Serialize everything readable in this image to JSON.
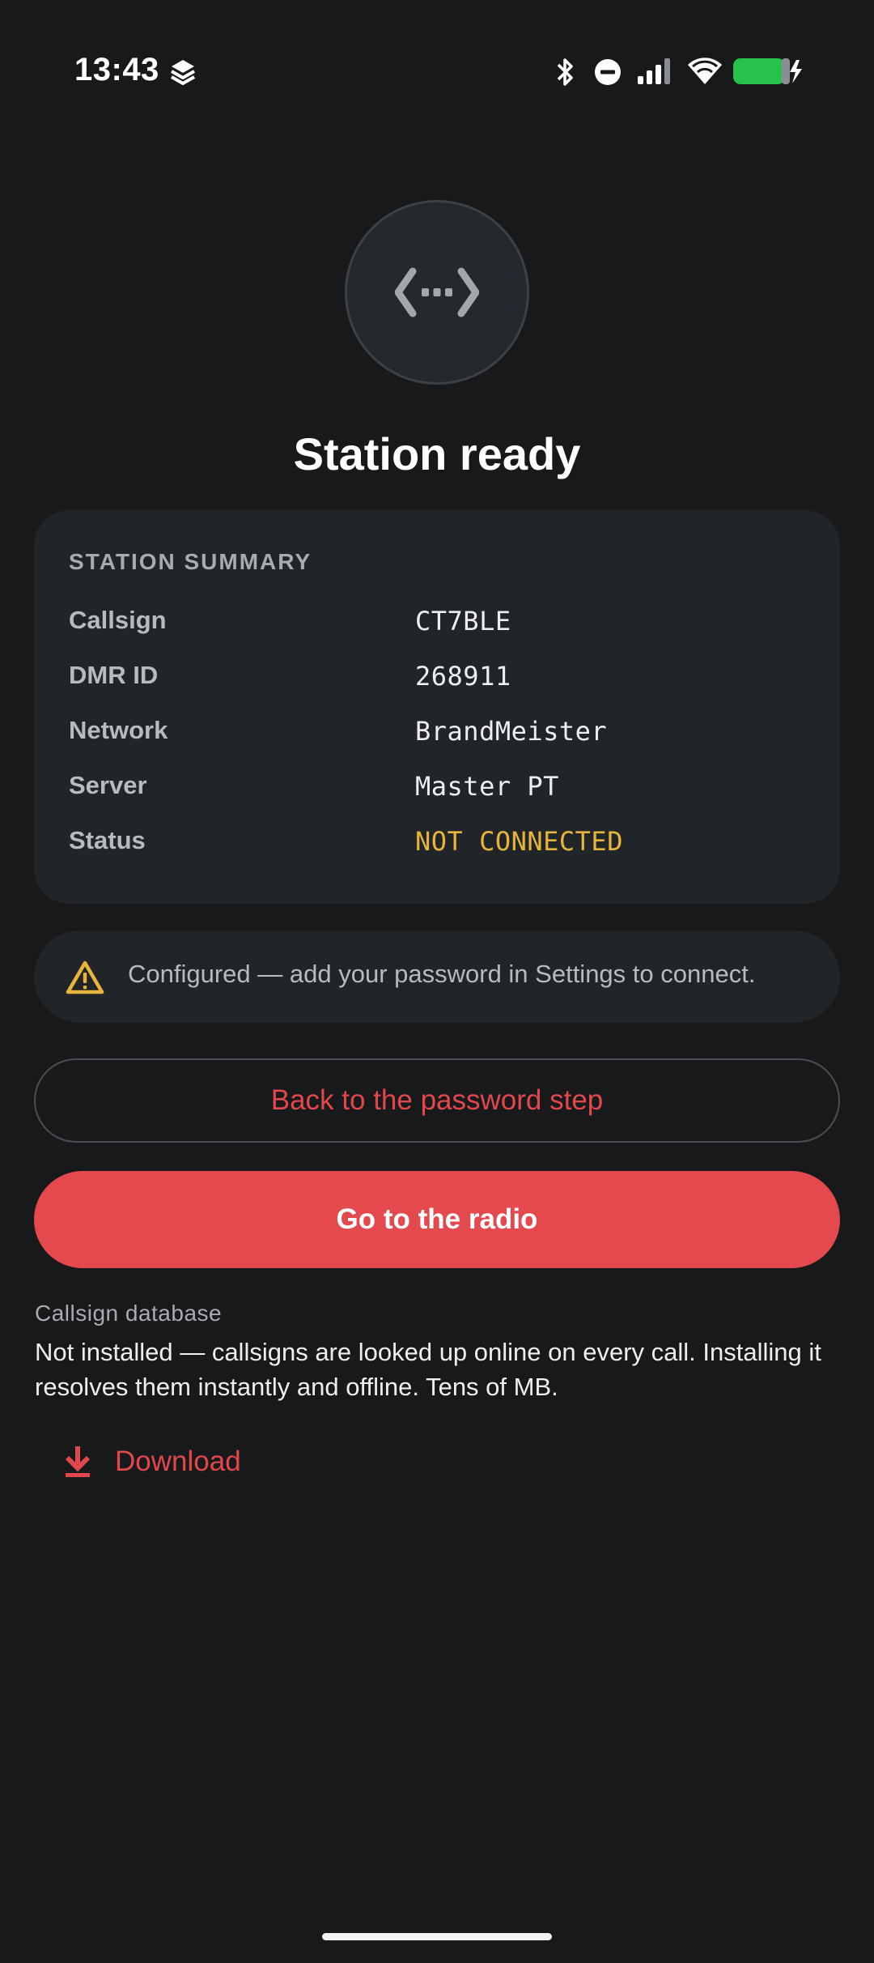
{
  "status_bar": {
    "time": "13:43",
    "icons": [
      "app-notification-icon",
      "bluetooth-icon",
      "do-not-disturb-icon",
      "signal-icon",
      "wifi-icon",
      "battery-charging-icon"
    ],
    "battery_color": "#27c24c"
  },
  "hero": {
    "icon": "code-connection-icon",
    "title": "Station ready"
  },
  "summary": {
    "heading": "STATION SUMMARY",
    "rows": [
      {
        "label": "Callsign",
        "value": "CT7BLE"
      },
      {
        "label": "DMR ID",
        "value": "268911"
      },
      {
        "label": "Network",
        "value": "BrandMeister"
      },
      {
        "label": "Server",
        "value": "Master PT"
      },
      {
        "label": "Status",
        "value": "NOT CONNECTED"
      }
    ]
  },
  "notice": {
    "icon": "warning-icon",
    "text": "Configured — add your password in Settings to connect."
  },
  "actions": {
    "back_label": "Back to the password step",
    "primary_label": "Go to the radio"
  },
  "callsign_db": {
    "label": "Callsign database",
    "description": "Not installed — callsigns are looked up online on every call. Installing it resolves them instantly and offline. Tens of MB.",
    "download_label": "Download",
    "download_icon": "download-icon"
  },
  "colors": {
    "accent": "#e44a4d",
    "warning": "#e7b43c",
    "background": "#18191b",
    "card": "#222528"
  }
}
